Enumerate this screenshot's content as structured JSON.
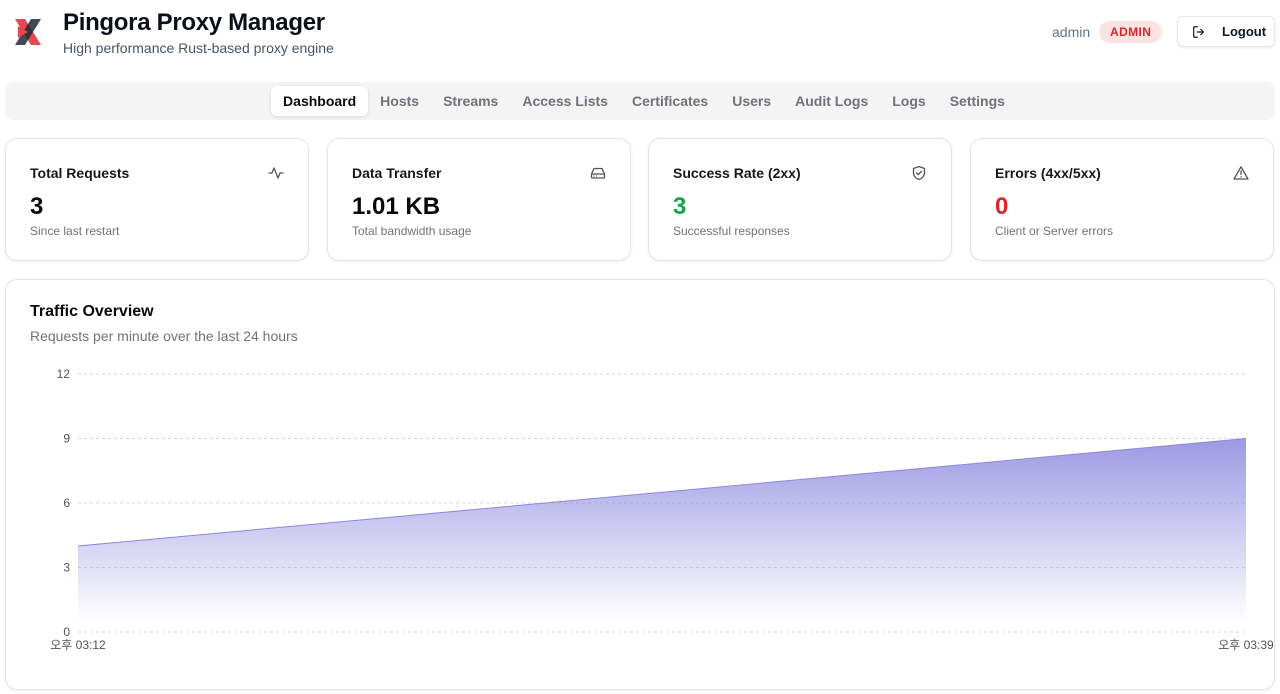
{
  "app": {
    "title": "Pingora Proxy Manager",
    "subtitle": "High performance Rust-based proxy engine",
    "logo_icon": "x-logo-icon",
    "accent_colors": [
      "#e5484d",
      "#1f2937"
    ]
  },
  "user": {
    "name": "admin",
    "role": "ADMIN",
    "logout_label": "Logout"
  },
  "nav": {
    "tabs": [
      {
        "label": "Dashboard",
        "active": true
      },
      {
        "label": "Hosts",
        "active": false
      },
      {
        "label": "Streams",
        "active": false
      },
      {
        "label": "Access Lists",
        "active": false
      },
      {
        "label": "Certificates",
        "active": false
      },
      {
        "label": "Users",
        "active": false
      },
      {
        "label": "Audit Logs",
        "active": false
      },
      {
        "label": "Logs",
        "active": false
      },
      {
        "label": "Settings",
        "active": false
      }
    ]
  },
  "stats": [
    {
      "title": "Total Requests",
      "value": "3",
      "description": "Since last restart",
      "icon": "activity-icon"
    },
    {
      "title": "Data Transfer",
      "value": "1.01 KB",
      "description": "Total bandwidth usage",
      "icon": "hard-drive-icon"
    },
    {
      "title": "Success Rate (2xx)",
      "value": "3",
      "description": "Successful responses",
      "icon": "shield-check-icon",
      "value_color": "#16a34a"
    },
    {
      "title": "Errors (4xx/5xx)",
      "value": "0",
      "description": "Client or Server errors",
      "icon": "alert-triangle-icon",
      "value_color": "#dc2626"
    }
  ],
  "chart": {
    "title": "Traffic Overview",
    "subtitle": "Requests per minute over the last 24 hours"
  },
  "chart_data": {
    "type": "area",
    "title": "Traffic Overview",
    "subtitle": "Requests per minute over the last 24 hours",
    "x": [
      "오후 03:12",
      "오후 03:39"
    ],
    "series": [
      {
        "values": [
          4,
          9
        ],
        "color": "#8b87de"
      }
    ],
    "yticks": [
      0,
      3,
      6,
      9,
      12
    ],
    "ylim": [
      0,
      12
    ],
    "grid": true,
    "xlabel": "",
    "ylabel": ""
  }
}
